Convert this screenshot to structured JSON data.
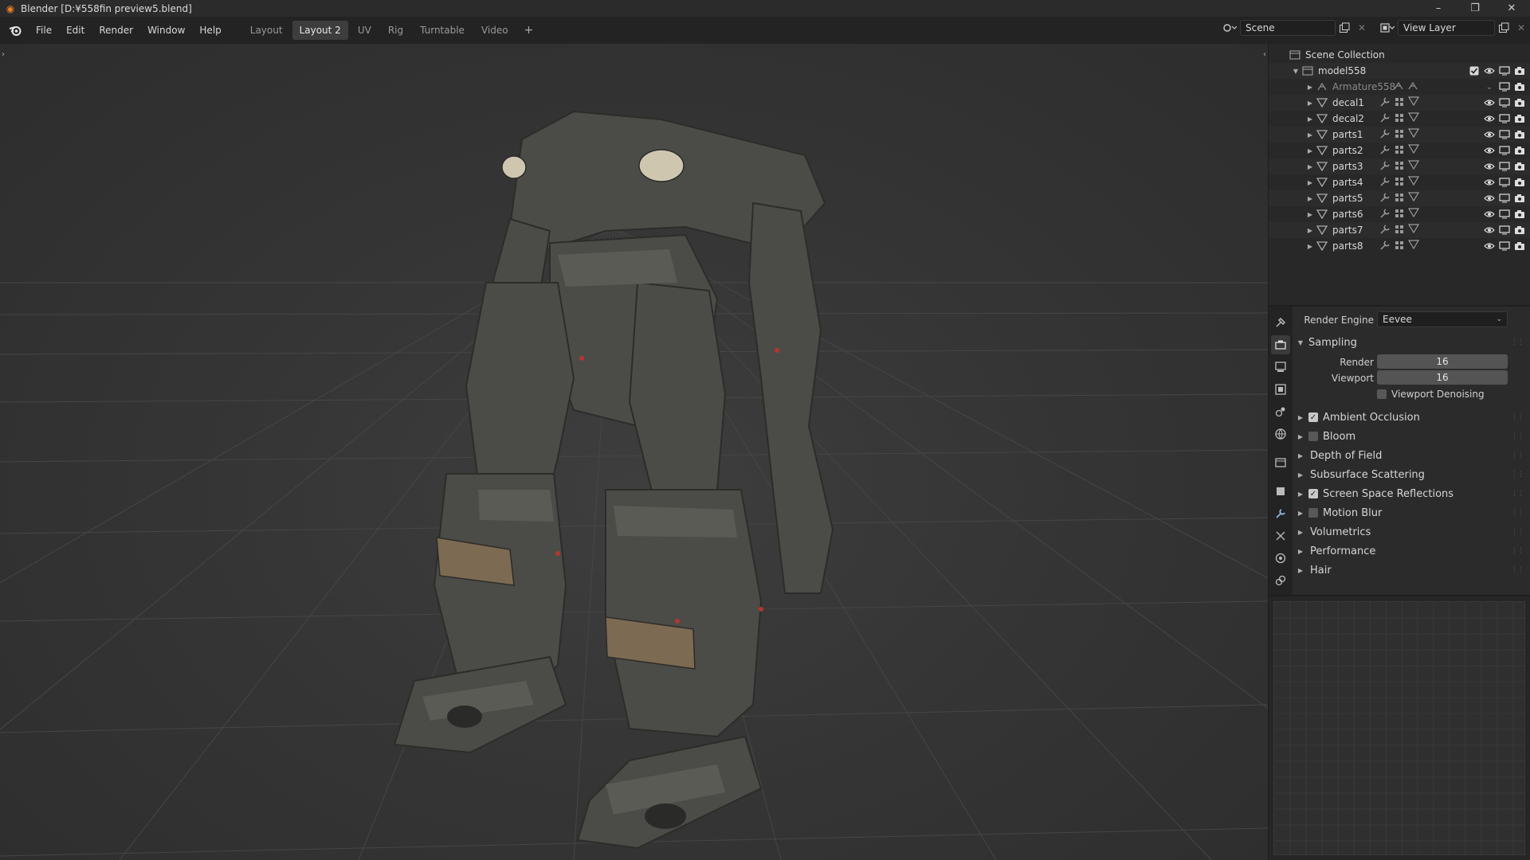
{
  "window": {
    "title": "Blender [D:¥558fin preview5.blend]",
    "controls": [
      "–",
      "❐",
      "✕"
    ]
  },
  "menu": [
    "File",
    "Edit",
    "Render",
    "Window",
    "Help"
  ],
  "workspace_tabs": [
    {
      "label": "Layout",
      "active": false
    },
    {
      "label": "Layout 2",
      "active": true
    },
    {
      "label": "UV",
      "active": false
    },
    {
      "label": "Rig",
      "active": false
    },
    {
      "label": "Turntable",
      "active": false
    },
    {
      "label": "Video",
      "active": false
    }
  ],
  "add_tab": "+",
  "scene": {
    "name": "Scene",
    "view_layer": "View Layer"
  },
  "outliner": {
    "root": "Scene Collection",
    "collection": "model558",
    "items": [
      {
        "name": "Armature558",
        "type": "armature",
        "muted": true
      },
      {
        "name": "decal1",
        "type": "mesh"
      },
      {
        "name": "decal2",
        "type": "mesh"
      },
      {
        "name": "parts1",
        "type": "mesh"
      },
      {
        "name": "parts2",
        "type": "mesh"
      },
      {
        "name": "parts3",
        "type": "mesh"
      },
      {
        "name": "parts4",
        "type": "mesh"
      },
      {
        "name": "parts5",
        "type": "mesh"
      },
      {
        "name": "parts6",
        "type": "mesh"
      },
      {
        "name": "parts7",
        "type": "mesh"
      },
      {
        "name": "parts8",
        "type": "mesh"
      }
    ]
  },
  "properties": {
    "render_engine_label": "Render Engine",
    "render_engine": "Eevee",
    "sampling": {
      "title": "Sampling",
      "render_label": "Render",
      "render": "16",
      "viewport_label": "Viewport",
      "viewport": "16",
      "denoise_label": "Viewport Denoising",
      "denoise": false
    },
    "panels": [
      {
        "label": "Ambient Occlusion",
        "checkbox": true,
        "checked": true
      },
      {
        "label": "Bloom",
        "checkbox": true,
        "checked": false
      },
      {
        "label": "Depth of Field",
        "checkbox": false
      },
      {
        "label": "Subsurface Scattering",
        "checkbox": false
      },
      {
        "label": "Screen Space Reflections",
        "checkbox": true,
        "checked": true
      },
      {
        "label": "Motion Blur",
        "checkbox": true,
        "checked": false
      },
      {
        "label": "Volumetrics",
        "checkbox": false
      },
      {
        "label": "Performance",
        "checkbox": false
      },
      {
        "label": "Hair",
        "checkbox": false
      }
    ]
  },
  "colors": {
    "accent_orange": "#e8802a",
    "robot_body": "#4b4c47",
    "robot_tan": "#7d6a52"
  }
}
